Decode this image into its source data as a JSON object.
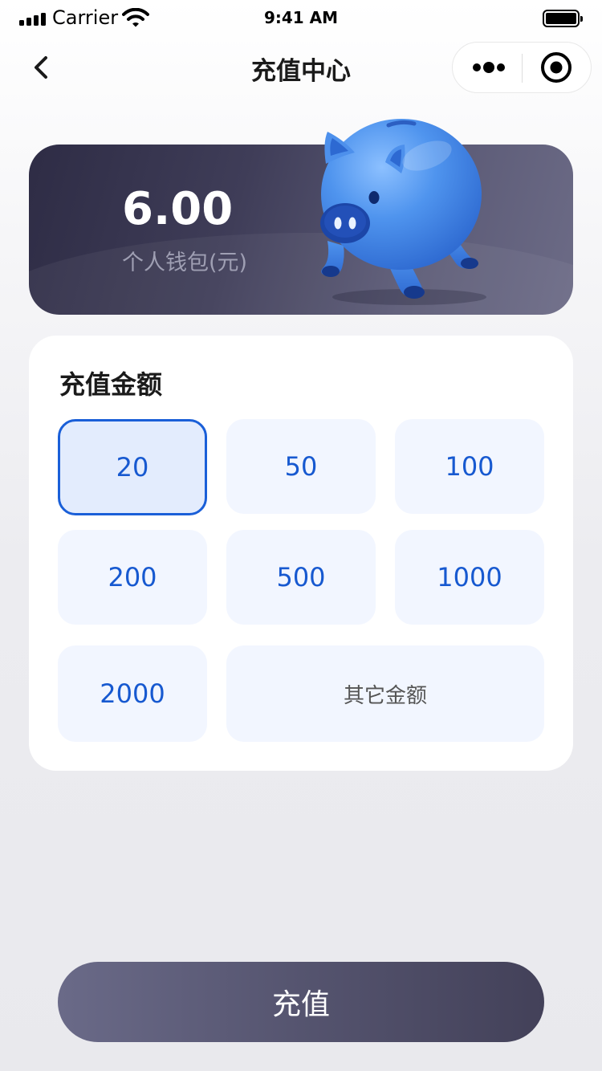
{
  "status_bar": {
    "carrier": "Carrier",
    "time": "9:41 AM"
  },
  "nav": {
    "title": "充值中心",
    "back_icon": "chevron-left-icon",
    "more_icon": "more-dots-icon",
    "close_icon": "target-close-icon"
  },
  "wallet": {
    "balance": "6.00",
    "label": "个人钱包(元)",
    "illustration": "piggy-bank-icon"
  },
  "amounts": {
    "title": "充值金额",
    "options": [
      "20",
      "50",
      "100",
      "200",
      "500",
      "1000",
      "2000"
    ],
    "selected": "20",
    "other_label": "其它金额"
  },
  "recharge_button": {
    "label": "充值"
  },
  "colors": {
    "accent": "#1a5fd8",
    "card_dark": "#2e2c45",
    "button": "#55546f",
    "piggy": "#4a8fea"
  }
}
